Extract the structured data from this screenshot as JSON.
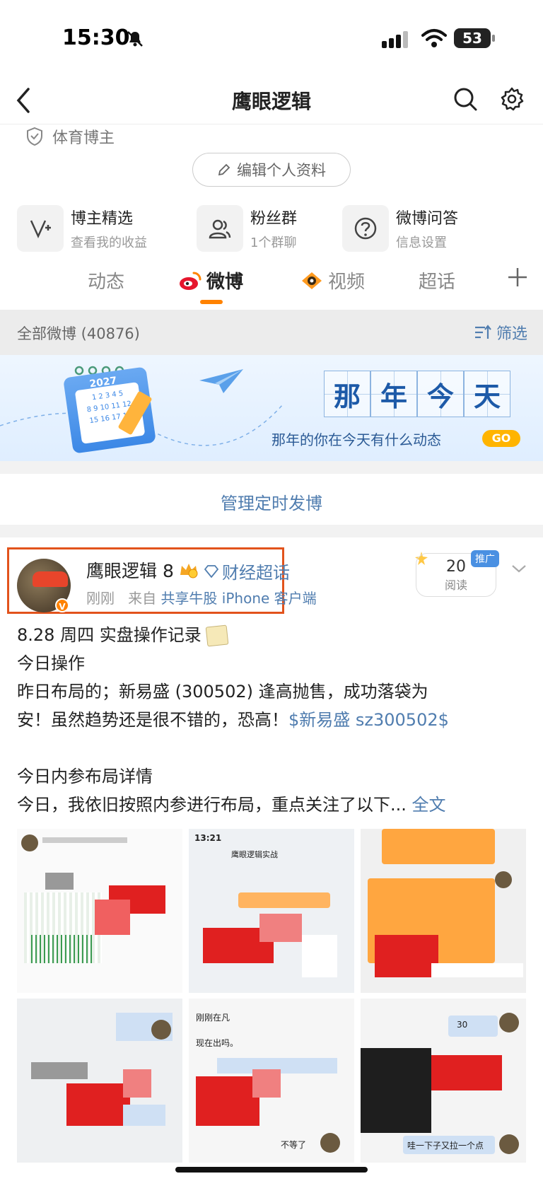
{
  "status_bar": {
    "time": "15:30",
    "battery": "53"
  },
  "nav": {
    "title": "鹰眼逻辑"
  },
  "profile": {
    "tag": "体育博主",
    "edit_button": "编辑个人资料",
    "shortcuts": [
      {
        "title": "博主精选",
        "subtitle": "查看我的收益"
      },
      {
        "title": "粉丝群",
        "subtitle": "1个群聊"
      },
      {
        "title": "微博问答",
        "subtitle": "信息设置"
      }
    ],
    "tabs": [
      "动态",
      "微博",
      "视频",
      "超话"
    ]
  },
  "filter_bar": {
    "count_label": "全部微博 (40876)",
    "filter_label": "筛选"
  },
  "banner": {
    "year": "2027",
    "title_chars": [
      "那",
      "年",
      "今",
      "天"
    ],
    "subtitle": "那年的你在今天有什么动态",
    "go": "GO"
  },
  "manage": {
    "label": "管理定时发博"
  },
  "post": {
    "author": "鹰眼逻辑 8",
    "topic": "财经超话",
    "time": "刚刚",
    "source_prefix": "来自",
    "source": "共享牛股 iPhone 客户端",
    "read_count": "20",
    "read_label": "阅读",
    "promo": "推广",
    "lines": {
      "l1": "8.28 周四 实盘操作记录",
      "l2": "今日操作",
      "l3": "昨日布局的；新易盛 (300502) 逢高抛售，成功落袋为",
      "l4a": "安！虽然趋势还是很不错的，恐高！",
      "l4b": "$新易盛 sz300502$",
      "l5": "今日内参布局详情",
      "l6a": "今日，我依旧按照内参进行布局，重点关注了以下...",
      "l6b": "全文"
    },
    "image_snippets": {
      "t2_time": "13:21",
      "t2_title": "鹰眼逻辑实战",
      "t5_a": "刚刚在凡",
      "t5_b": "现在出吗。",
      "t6_a": "30",
      "t6_b": "哇一下子又拉一个点",
      "t5_c": "不等了"
    }
  }
}
